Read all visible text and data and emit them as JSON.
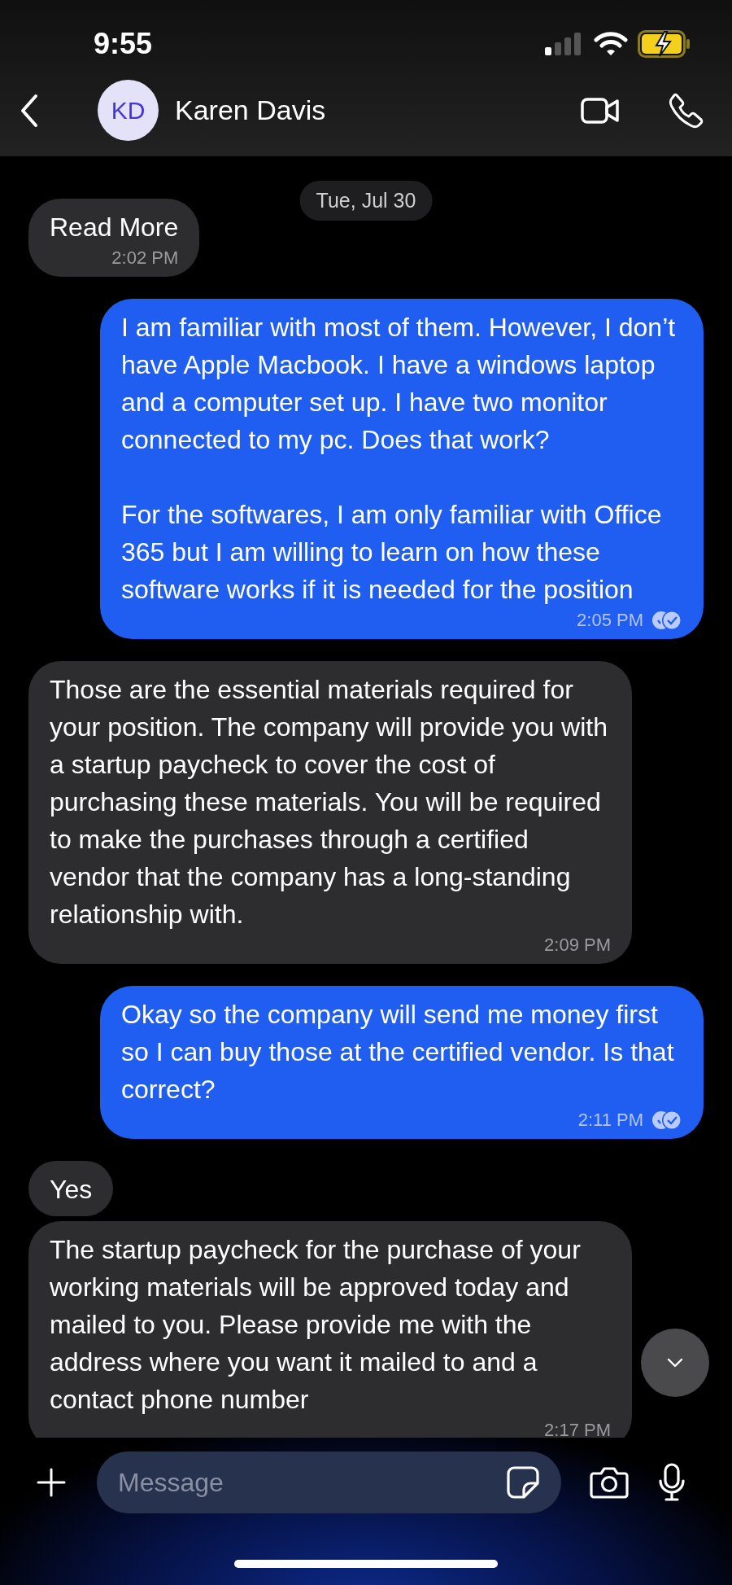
{
  "status_bar": {
    "time": "9:55"
  },
  "header": {
    "avatar_initials": "KD",
    "contact_name": "Karen Davis"
  },
  "date_separator": "Tue, Jul 30",
  "messages": [
    {
      "kind": "incoming",
      "paragraphs": [
        "Read More"
      ],
      "time": "2:02 PM"
    },
    {
      "kind": "outgoing",
      "paragraphs": [
        "I am familiar with most of them. However, I don’t have Apple Macbook. I have a windows laptop and a computer set up. I have two monitor connected to my pc. Does that work?",
        "For the softwares, I am only familiar with Office 365 but I am willing to learn on how these software works if it is needed for the position"
      ],
      "time": "2:05 PM",
      "read": true
    },
    {
      "kind": "incoming",
      "paragraphs": [
        "Those are the essential materials required for your position. The company will provide you with a startup paycheck to cover the cost of purchasing these materials. You will be required to make the purchases through a certified vendor that the company has a long-standing relationship with."
      ],
      "time": "2:09 PM"
    },
    {
      "kind": "outgoing",
      "paragraphs": [
        "Okay so the company will send me money first so I can buy those at the certified vendor. Is that correct?"
      ],
      "time": "2:11 PM",
      "read": true
    },
    {
      "kind": "incoming",
      "paragraphs": [
        "Yes"
      ]
    },
    {
      "kind": "incoming",
      "paragraphs": [
        "The startup paycheck for the purchase of your working materials will be approved today and mailed to you. Please provide me with the address where you want it mailed to and a contact phone number"
      ],
      "time": "2:17 PM"
    }
  ],
  "composer": {
    "placeholder": "Message"
  }
}
